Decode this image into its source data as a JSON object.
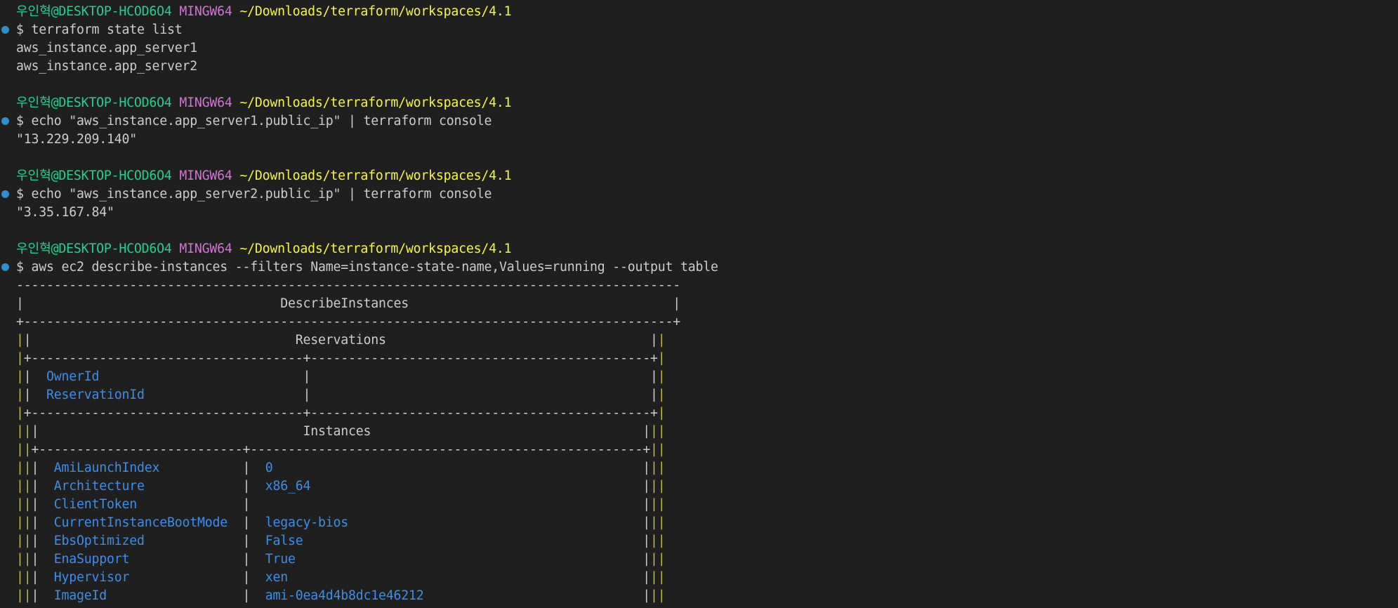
{
  "prompt": {
    "user": "우인혁",
    "host": "@DESKTOP-HCOD6O4",
    "system": "MINGW64",
    "path": "~/Downloads/terraform/workspaces/4.1"
  },
  "blocks": [
    {
      "command": "$ terraform state list",
      "output": [
        "aws_instance.app_server1",
        "aws_instance.app_server2"
      ]
    },
    {
      "command": "$ echo \"aws_instance.app_server1.public_ip\" | terraform console",
      "output": [
        "\"13.229.209.140\""
      ]
    },
    {
      "command": "$ echo \"aws_instance.app_server2.public_ip\" | terraform console",
      "output": [
        "\"3.35.167.84\""
      ]
    },
    {
      "command": "$ aws ec2 describe-instances --filters Name=instance-state-name,Values=running --output table",
      "output": []
    }
  ],
  "table": {
    "title": "DescribeInstances",
    "reservations_title": "Reservations",
    "reservation_rows": [
      {
        "key": "OwnerId",
        "value": ""
      },
      {
        "key": "ReservationId",
        "value": ""
      }
    ],
    "instances_title": "Instances",
    "instance_rows": [
      {
        "key": "AmiLaunchIndex",
        "value": "0"
      },
      {
        "key": "Architecture",
        "value": "x86_64"
      },
      {
        "key": "ClientToken",
        "value": ""
      },
      {
        "key": "CurrentInstanceBootMode",
        "value": "legacy-bios"
      },
      {
        "key": "EbsOptimized",
        "value": "False"
      },
      {
        "key": "EnaSupport",
        "value": "True"
      },
      {
        "key": "Hypervisor",
        "value": "xen"
      },
      {
        "key": "ImageId",
        "value": "ami-0ea4d4b8dc1e46212"
      }
    ]
  },
  "colors": {
    "background": "#1f1f1f",
    "prompt_user": "#23d18b",
    "prompt_system": "#d670d6",
    "prompt_path": "#f5f543",
    "table_key": "#3b8eea",
    "decoration_dot": "#2f8fcb"
  }
}
